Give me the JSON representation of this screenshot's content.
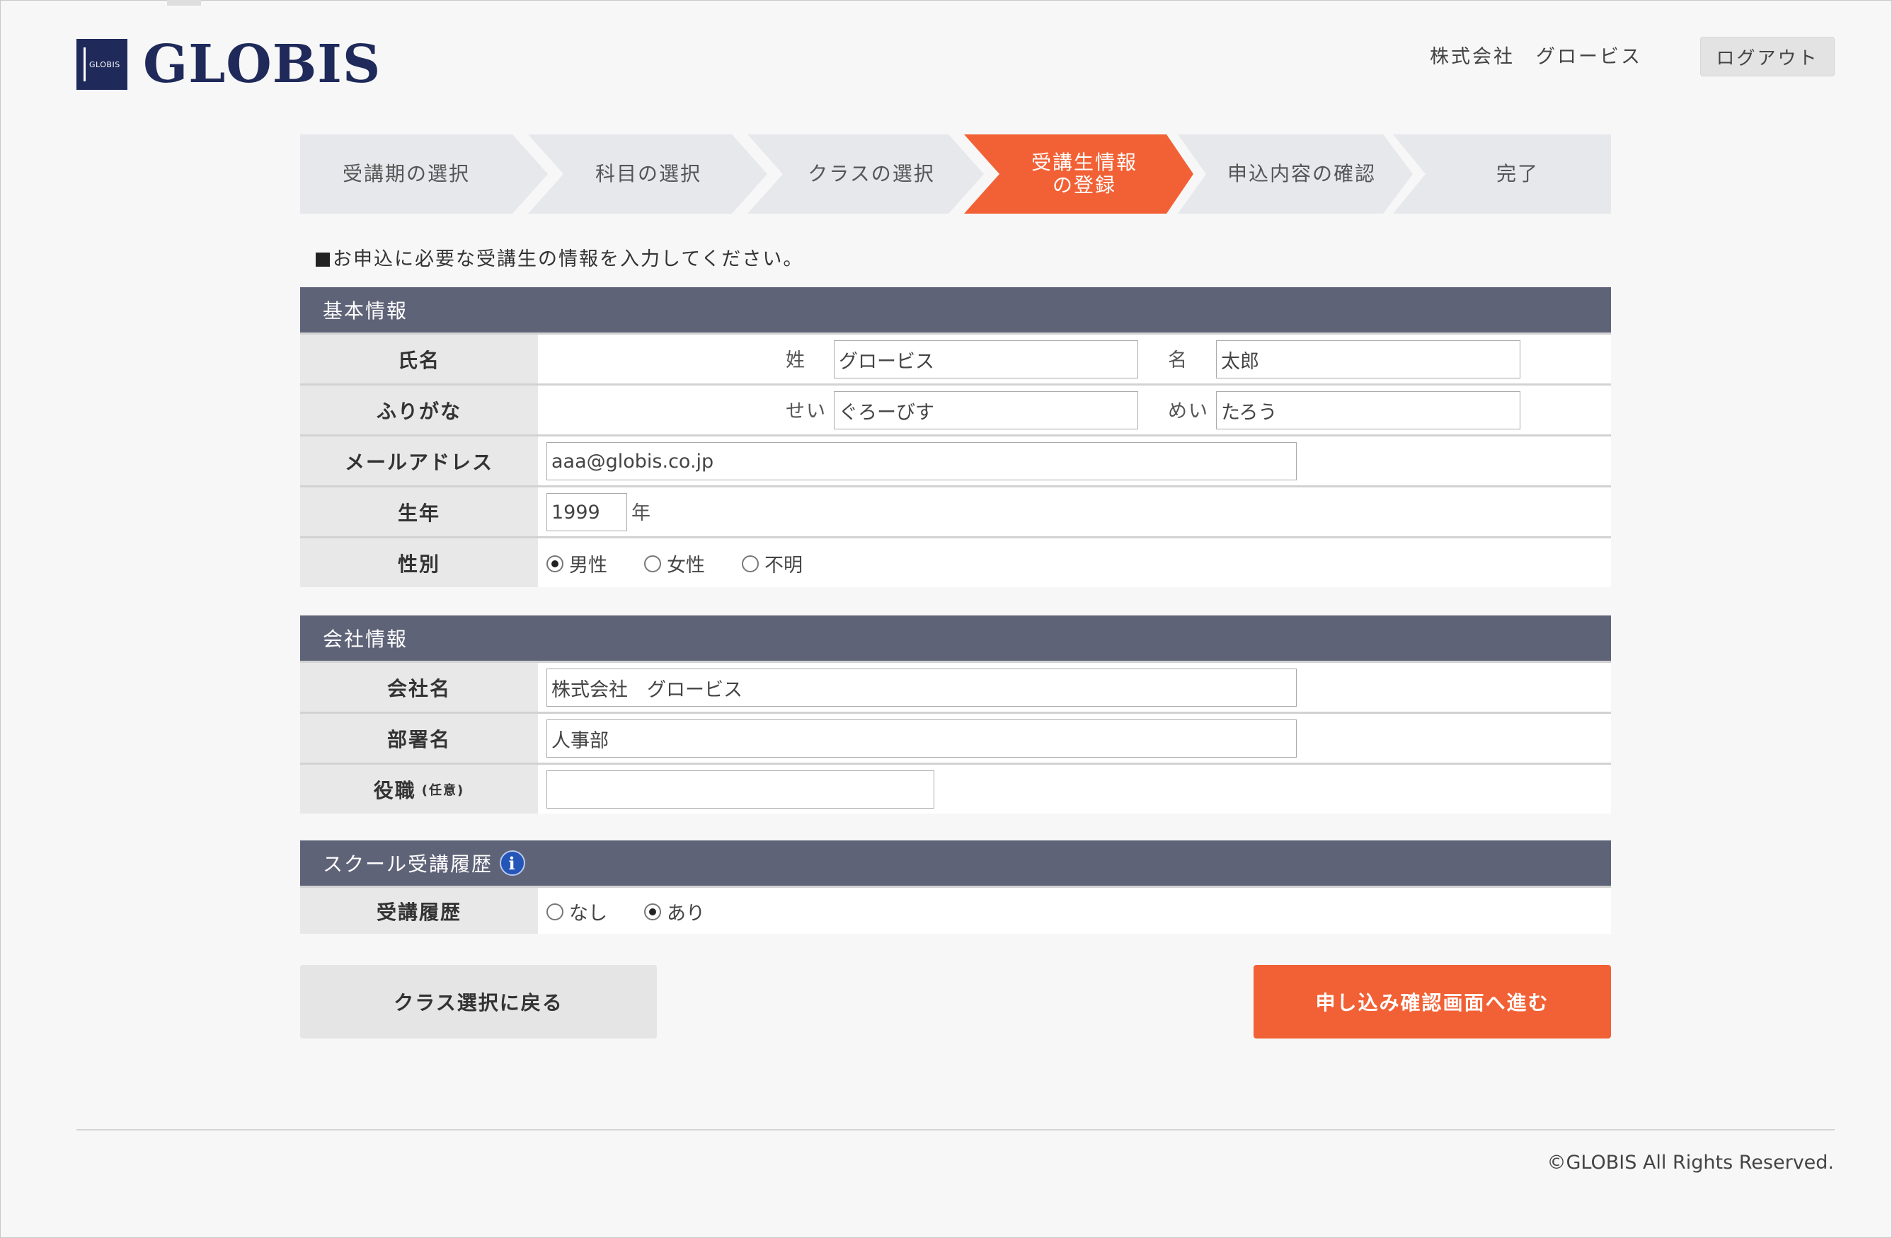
{
  "header": {
    "logo_text": "GLOBIS",
    "logo_mark_text": "GLOBIS",
    "company_name": "株式会社　グロービス",
    "logout_label": "ログアウト"
  },
  "steps": [
    {
      "label": "受講期の選択",
      "active": false
    },
    {
      "label": "科目の選択",
      "active": false
    },
    {
      "label": "クラスの選択",
      "active": false
    },
    {
      "label": "受講生情報\nの登録",
      "active": true
    },
    {
      "label": "申込内容の確認",
      "active": false
    },
    {
      "label": "完了",
      "active": false
    }
  ],
  "instruction": "お申込に必要な受講生の情報を入力してください。",
  "basic": {
    "title": "基本情報",
    "name": {
      "label": "氏名",
      "last_label": "姓",
      "last_value": "グロービス",
      "first_label": "名",
      "first_value": "太郎"
    },
    "furigana": {
      "label": "ふりがな",
      "last_label": "せい",
      "last_value": "ぐろーびす",
      "first_label": "めい",
      "first_value": "たろう"
    },
    "email": {
      "label": "メールアドレス",
      "value": "aaa@globis.co.jp"
    },
    "birth_year": {
      "label": "生年",
      "value": "1999",
      "unit": "年"
    },
    "gender": {
      "label": "性別",
      "options": [
        "男性",
        "女性",
        "不明"
      ],
      "selected": "男性"
    }
  },
  "company": {
    "title": "会社情報",
    "company_name": {
      "label": "会社名",
      "value": "株式会社　グロービス"
    },
    "department": {
      "label": "部署名",
      "value": "人事部"
    },
    "position": {
      "label": "役職",
      "optional": "(任意)",
      "value": ""
    }
  },
  "history": {
    "title": "スクール受講履歴",
    "info_icon": "info-icon",
    "row": {
      "label": "受講履歴",
      "options": [
        "なし",
        "あり"
      ],
      "selected": "あり"
    }
  },
  "buttons": {
    "back_label": "クラス選択に戻る",
    "next_label": "申し込み確認画面へ進む"
  },
  "footer": {
    "copyright": "©GLOBIS All Rights Reserved."
  },
  "colors": {
    "brand": "#1f2a5a",
    "accent": "#f26135",
    "section_header": "#5f6378",
    "step_inactive": "#e6e8ec"
  }
}
